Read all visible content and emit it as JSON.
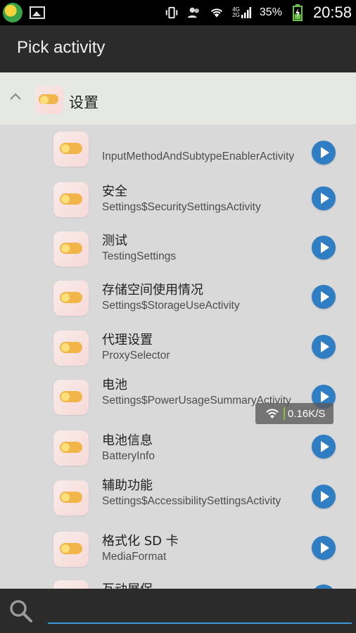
{
  "status_bar": {
    "battery_percent": "35%",
    "time": "20:58",
    "network_top": "4G",
    "network_bottom": "2G"
  },
  "app_bar": {
    "title": "Pick activity"
  },
  "group": {
    "label": "设置"
  },
  "activities": [
    {
      "name": "",
      "class": "InputMethodAndSubtypeEnablerActivity"
    },
    {
      "name": "安全",
      "class": "Settings$SecuritySettingsActivity"
    },
    {
      "name": "测试",
      "class": "TestingSettings"
    },
    {
      "name": "存储空间使用情况",
      "class": "Settings$StorageUseActivity"
    },
    {
      "name": "代理设置",
      "class": "ProxySelector"
    },
    {
      "name": "电池",
      "class": "Settings$PowerUsageSummaryActivity"
    },
    {
      "name": "电池信息",
      "class": "BatteryInfo"
    },
    {
      "name": "辅助功能",
      "class": "Settings$AccessibilitySettingsActivity"
    },
    {
      "name": "格式化 SD 卡",
      "class": "MediaFormat"
    },
    {
      "name": "互动展保",
      "class": ""
    }
  ],
  "speed_indicator": {
    "value": "0.16K/S"
  },
  "search": {
    "placeholder": "",
    "value": ""
  },
  "colors": {
    "accent": "#2f7dc3",
    "toolbar": "#2b2b2b",
    "list_bg": "#d9d9d9"
  }
}
